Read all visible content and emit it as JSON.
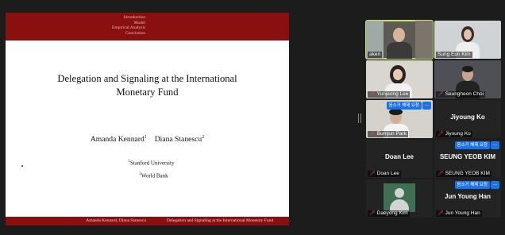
{
  "slide": {
    "nav_items": [
      "Introduction",
      "Model",
      "Empirical Analysis",
      "Conclusion"
    ],
    "title_line1": "Delegation and Signaling at the International",
    "title_line2": "Monetary Fund",
    "author1": "Amanda Kennard",
    "author1_mark": "1",
    "author2": "Diana Stanescu",
    "author2_mark": "2",
    "affil1_mark": "1",
    "affil1": "Stanford University",
    "affil2_mark": "2",
    "affil2": "World Bank",
    "footer_authors": "Amanda Kennard, Diana Stanescu",
    "footer_title": "Delegation and Signaling at the International Monetary Fund"
  },
  "participants": [
    {
      "name": "aken"
    },
    {
      "name": "Sung Eun Kim"
    },
    {
      "name": "Yunjeong Lee"
    },
    {
      "name": "Seungheon Choi"
    },
    {
      "name": "Bumjun Park",
      "request_label": "음소거 해제 요청",
      "more_label": "..."
    },
    {
      "name": "Jiyoung Ko"
    },
    {
      "name": "Doan Lee"
    },
    {
      "name": "SEUNG YEOB KIM",
      "request_label": "음소거 해제 요청",
      "more_label": "..."
    },
    {
      "name": "Daeyong Kim"
    },
    {
      "name": "Jun Young Han",
      "request_label": "음소거 해제 요청",
      "more_label": "..."
    }
  ],
  "icons": {
    "muted_mic": "muted-mic-icon"
  },
  "colors": {
    "slide_accent": "#8a1010",
    "active_speaker": "#c8e25a",
    "request_button": "#1a73e8",
    "muted": "#e84a4a"
  }
}
